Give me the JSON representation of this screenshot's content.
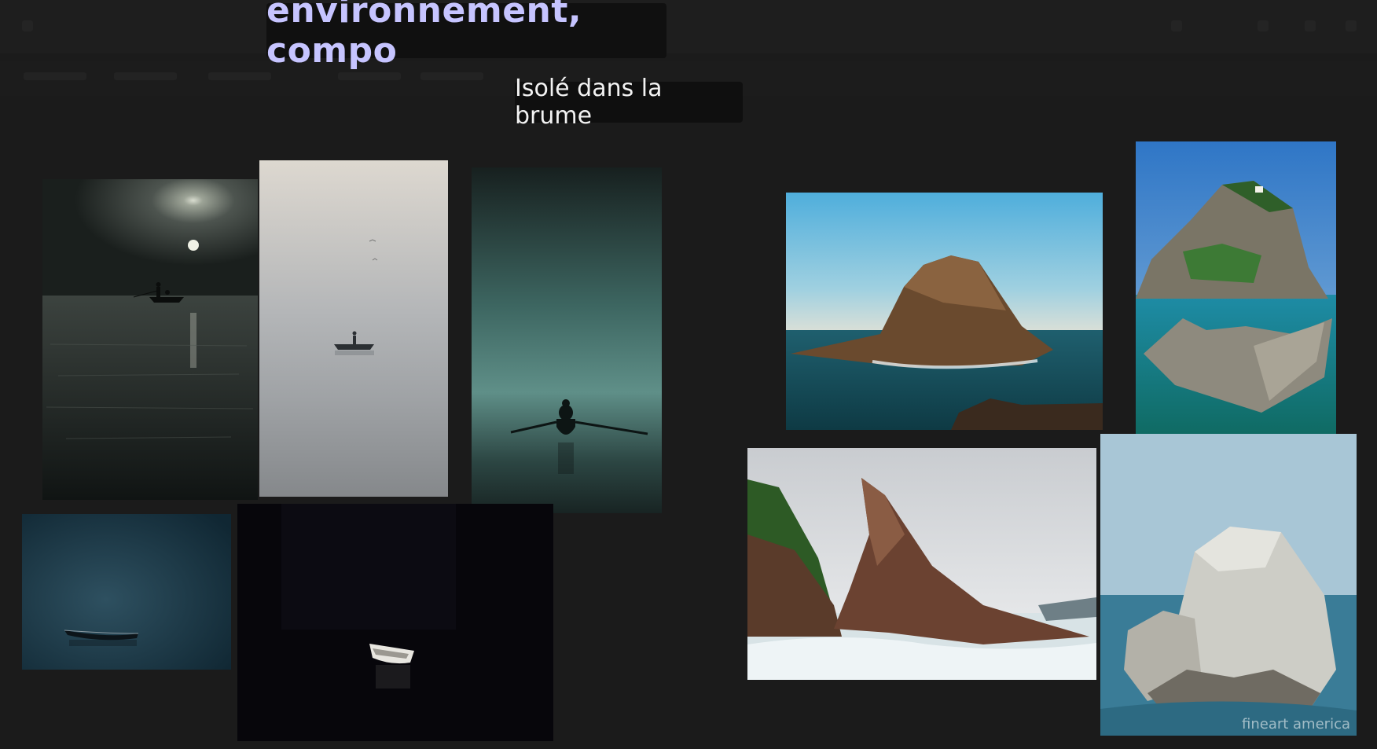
{
  "board": {
    "title": "environnement, compo",
    "subtitle": "Isolé dans la brume"
  },
  "photos": [
    {
      "name": "photo-fisherman-moonlit-mist",
      "subject": "two fishermen in small boat under hazy moon"
    },
    {
      "name": "photo-rowboat-white-fog",
      "subject": "lone figure in rowboat in white fog"
    },
    {
      "name": "photo-rower-teal-fog",
      "subject": "rower with oars in teal fog"
    },
    {
      "name": "photo-empty-boat-dark-water",
      "subject": "empty wooden boat on dark blue water"
    },
    {
      "name": "photo-white-boat-night",
      "subject": "small white boat on black water"
    },
    {
      "name": "photo-rock-island-sea",
      "subject": "brown rocky islet in sea"
    },
    {
      "name": "photo-chapel-on-rock",
      "subject": "chapel on top of rocky island with turquoise water"
    },
    {
      "name": "photo-jagged-sea-cliff",
      "subject": "jagged tilted sea cliff with surf"
    },
    {
      "name": "photo-white-boulder-sea",
      "subject": "large white boulder in sea",
      "watermark": "fineart america"
    }
  ]
}
